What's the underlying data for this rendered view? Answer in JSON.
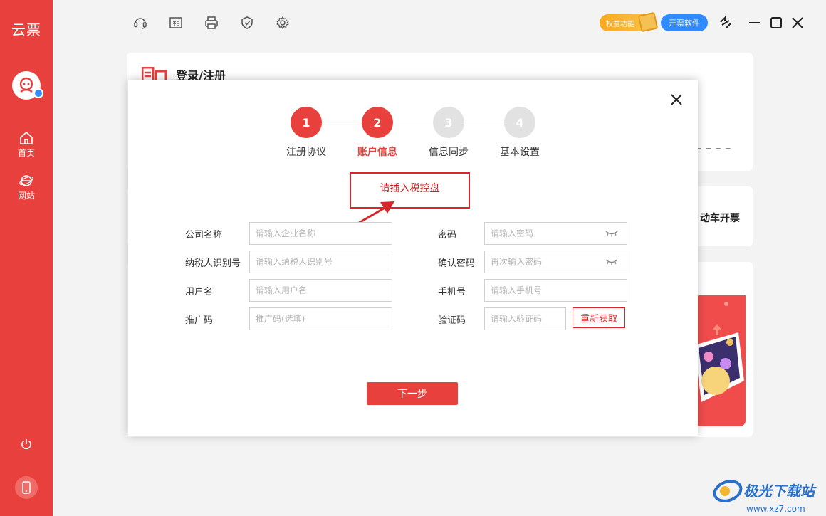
{
  "app": {
    "brand": "云票"
  },
  "sidebar": {
    "items": [
      {
        "label": "首页",
        "icon": "home-icon"
      },
      {
        "label": "网站",
        "icon": "browser-icon"
      }
    ],
    "bottom_icons": [
      "power-icon",
      "phone-icon"
    ]
  },
  "toolbar": {
    "icons": [
      "headset-icon",
      "invoice-icon",
      "printer-icon",
      "shield-icon",
      "gear-icon"
    ],
    "benefit_label": "权益功能",
    "invoice_software_label": "开票软件",
    "window_icons": [
      "swap-icon",
      "minimize-icon",
      "maximize-icon",
      "close-icon"
    ]
  },
  "background": {
    "title": "登录/注册",
    "dashes": "_ _ _ _",
    "right_text": "动车开票"
  },
  "modal": {
    "steps": [
      {
        "number": "1",
        "label": "注册协议",
        "state": "done"
      },
      {
        "number": "2",
        "label": "账户信息",
        "state": "current"
      },
      {
        "number": "3",
        "label": "信息同步",
        "state": "todo"
      },
      {
        "number": "4",
        "label": "基本设置",
        "state": "todo"
      }
    ],
    "warning": "请插入税控盘",
    "fields": {
      "company": {
        "label": "公司名称",
        "placeholder": "请输入企业名称"
      },
      "tax_id": {
        "label": "纳税人识别号",
        "placeholder": "请输入纳税人识别号"
      },
      "username": {
        "label": "用户名",
        "placeholder": "请输入用户名"
      },
      "promo": {
        "label": "推广码",
        "placeholder": "推广码(选填)"
      },
      "password": {
        "label": "密码",
        "placeholder": "请输入密码"
      },
      "confirm": {
        "label": "确认密码",
        "placeholder": "再次输入密码"
      },
      "phone": {
        "label": "手机号",
        "placeholder": "请输入手机号"
      },
      "code": {
        "label": "验证码",
        "placeholder": "请输入验证码"
      }
    },
    "refresh_label": "重新获取",
    "next_label": "下一步"
  },
  "watermark": {
    "text": "极光下载站",
    "url": "www.xz7.com"
  },
  "colors": {
    "accent": "#e8403c",
    "blue": "#2f8bff",
    "gold": "#f7a91d"
  }
}
